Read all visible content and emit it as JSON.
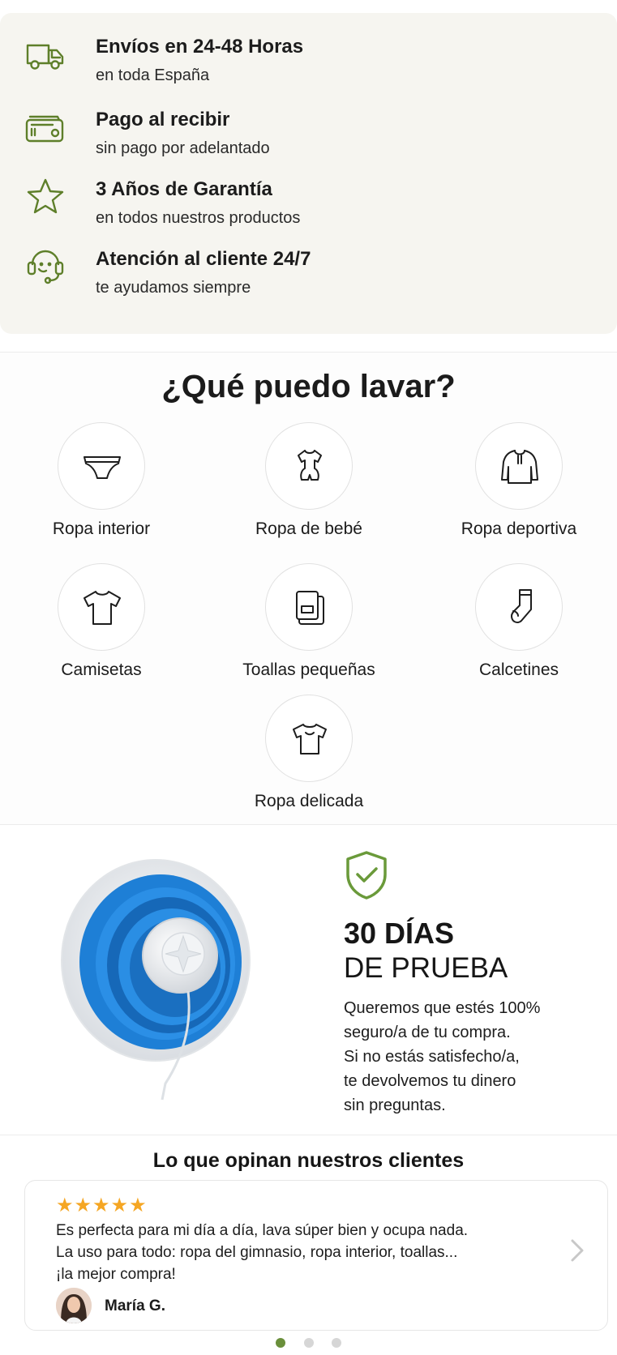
{
  "colors": {
    "accent": "#5e7f2a",
    "star": "#f5a623",
    "benefits_bg": "#f6f5f0",
    "product_blue": "#1e7fd6"
  },
  "benefits": [
    {
      "icon": "truck-icon",
      "title": "Envíos en 24-48 Horas",
      "subtitle": "en toda España"
    },
    {
      "icon": "wallet-icon",
      "title": "Pago al recibir",
      "subtitle": "sin pago por adelantado"
    },
    {
      "icon": "star-icon",
      "title": "3 Años de Garantía",
      "subtitle": "en todos nuestros productos"
    },
    {
      "icon": "support-icon",
      "title": "Atención al cliente 24/7",
      "subtitle": "te ayudamos siempre"
    }
  ],
  "wash": {
    "title": "¿Qué puedo lavar?",
    "items": [
      {
        "icon": "underwear-icon",
        "label": "Ropa interior"
      },
      {
        "icon": "baby-clothes-icon",
        "label": "Ropa de bebé"
      },
      {
        "icon": "hoodie-icon",
        "label": "Ropa deportiva"
      },
      {
        "icon": "tshirt-icon",
        "label": "Camisetas"
      },
      {
        "icon": "towel-icon",
        "label": "Toallas pequeñas"
      },
      {
        "icon": "sock-icon",
        "label": "Calcetines"
      },
      {
        "icon": "delicate-shirt-icon",
        "label": "Ropa delicada"
      }
    ]
  },
  "trial": {
    "heading_strong": "30 DÍAS",
    "heading_light": "DE PRUEBA",
    "lines": [
      "Queremos que estés 100%",
      "seguro/a de tu compra.",
      "Si no estás satisfecho/a,",
      "te devolvemos tu dinero",
      "sin preguntas."
    ]
  },
  "reviews": {
    "title": "Lo que opinan nuestros clientes",
    "rating": 5,
    "items": [
      {
        "stars": "★★★★★",
        "lines": [
          "Es perfecta para mi día a día, lava súper bien y ocupa nada.",
          "La uso para todo: ropa del gimnasio, ropa interior, toallas...",
          "¡la mejor compra!"
        ],
        "author": "María G."
      }
    ],
    "page_count": 3,
    "active_page": 1
  }
}
